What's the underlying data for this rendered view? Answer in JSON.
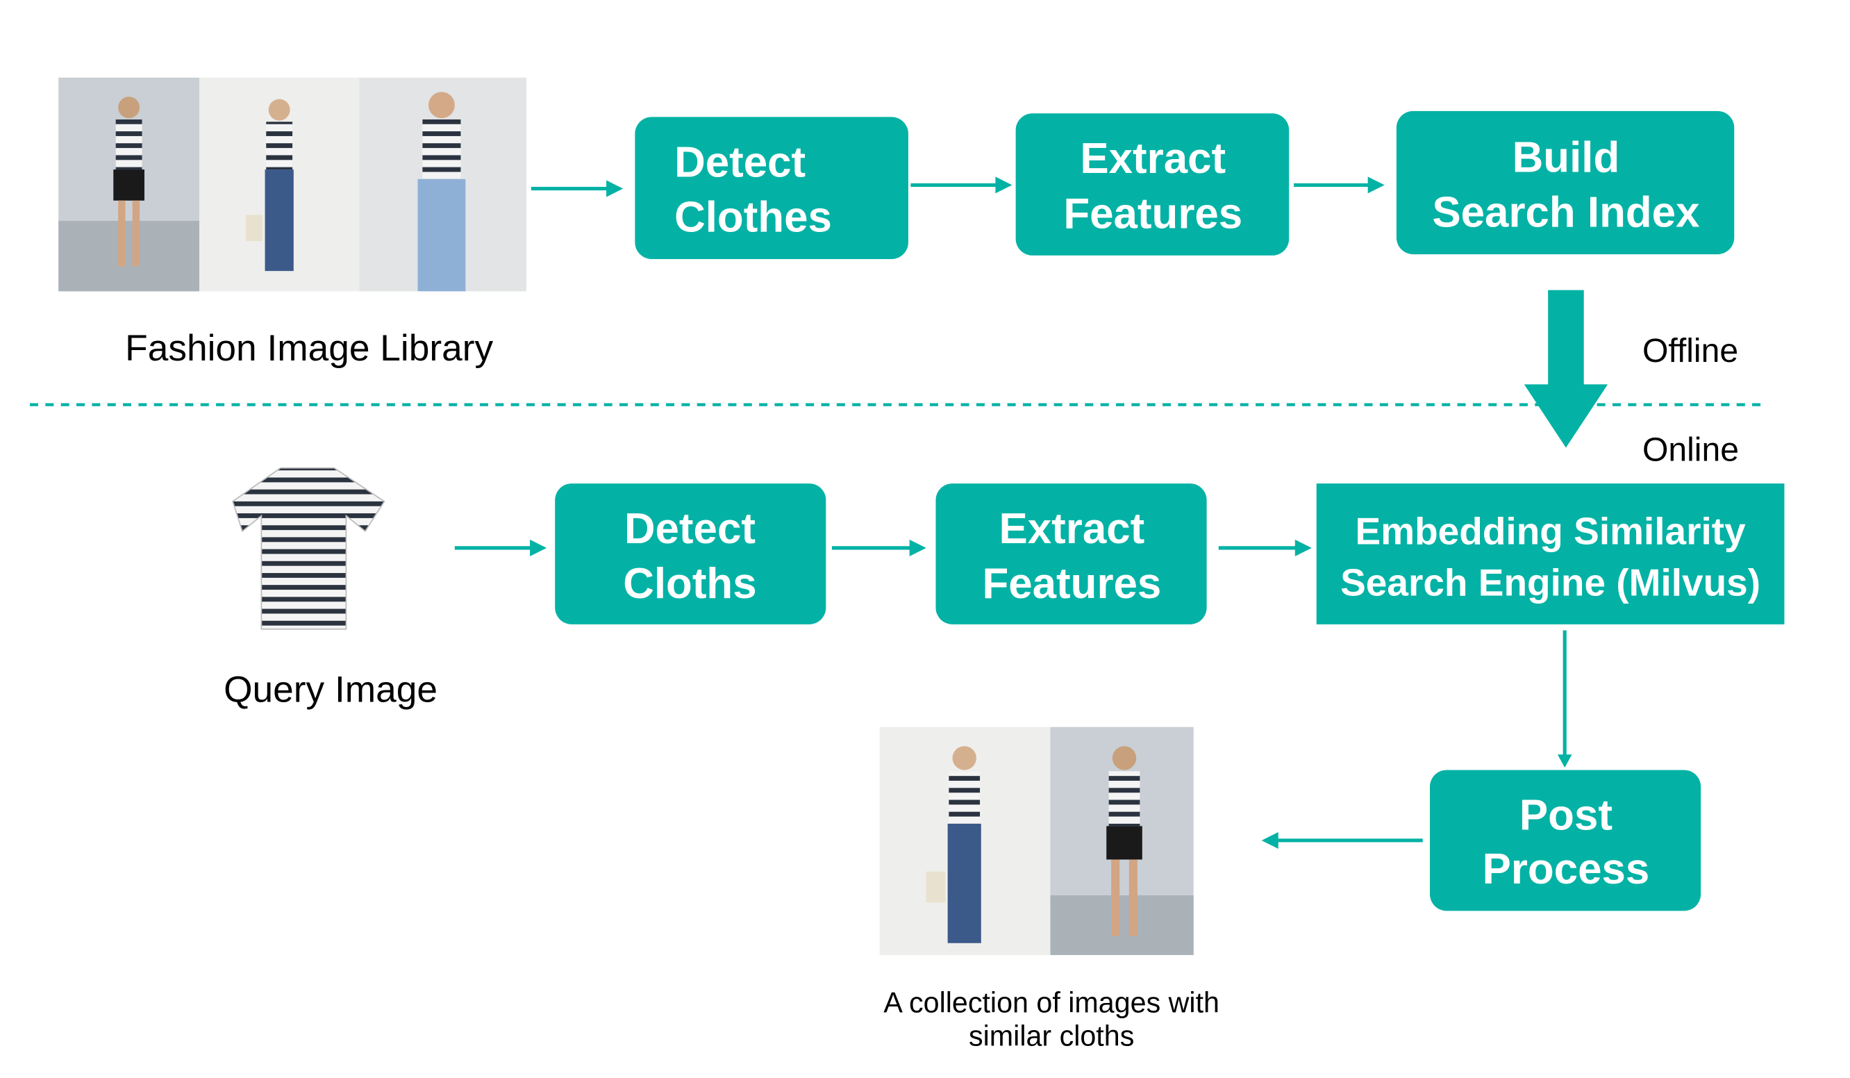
{
  "colors": {
    "accent": "#03b2a5"
  },
  "offline": {
    "library_label": "Fashion Image Library",
    "steps": [
      {
        "line1": "Detect",
        "line2": "Clothes"
      },
      {
        "line1": "Extract",
        "line2": "Features"
      },
      {
        "line1": "Build",
        "line2": "Search Index"
      }
    ],
    "section_label": "Offline"
  },
  "online": {
    "section_label": "Online",
    "query_label": "Query Image",
    "steps": [
      {
        "line1": "Detect",
        "line2": "Cloths"
      },
      {
        "line1": "Extract",
        "line2": "Features"
      },
      {
        "line1": "Embedding Similarity",
        "line2": "Search Engine (Milvus)"
      },
      {
        "line1": "Post",
        "line2": "Process"
      }
    ],
    "result_caption": {
      "line1": "A collection of images with",
      "line2": "similar cloths"
    }
  }
}
